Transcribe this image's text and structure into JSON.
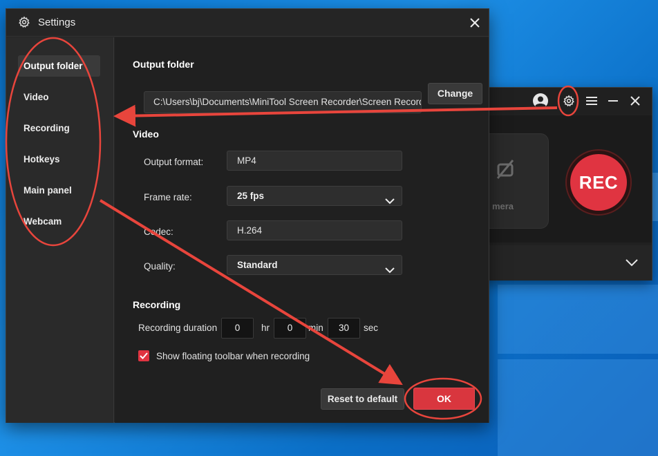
{
  "recorder": {
    "camera_label": "mera",
    "rec_label": "REC"
  },
  "settings": {
    "title": "Settings",
    "sidebar": {
      "items": [
        {
          "label": "Output folder",
          "active": true
        },
        {
          "label": "Video",
          "active": false
        },
        {
          "label": "Recording",
          "active": false
        },
        {
          "label": "Hotkeys",
          "active": false
        },
        {
          "label": "Main panel",
          "active": false
        },
        {
          "label": "Webcam",
          "active": false
        }
      ]
    },
    "output_folder": {
      "section_title": "Output folder",
      "path": "C:\\Users\\bj\\Documents\\MiniTool Screen Recorder\\Screen Recordings",
      "change_label": "Change"
    },
    "video": {
      "section_title": "Video",
      "output_format": {
        "label": "Output format:",
        "value": "MP4"
      },
      "frame_rate": {
        "label": "Frame rate:",
        "value": "25 fps"
      },
      "codec": {
        "label": "Codec:",
        "value": "H.264"
      },
      "quality": {
        "label": "Quality:",
        "value": "Standard"
      }
    },
    "recording": {
      "section_title": "Recording",
      "duration_label": "Recording duration",
      "hours": "0",
      "hours_unit": "hr",
      "minutes": "0",
      "minutes_unit": "min",
      "seconds": "30",
      "seconds_unit": "sec",
      "floating_toolbar": {
        "label": "Show floating toolbar when recording",
        "checked": true
      }
    },
    "footer": {
      "reset_label": "Reset to default",
      "ok_label": "OK"
    }
  },
  "colors": {
    "accent_red": "#e03441",
    "annotation_red": "#e8453c",
    "desktop_blue": "#0a78d4"
  },
  "icons": [
    "gear-icon",
    "close-icon",
    "user-icon",
    "menu-icon",
    "minimize-icon",
    "chevron-down-icon",
    "camera-off-icon",
    "check-icon"
  ]
}
